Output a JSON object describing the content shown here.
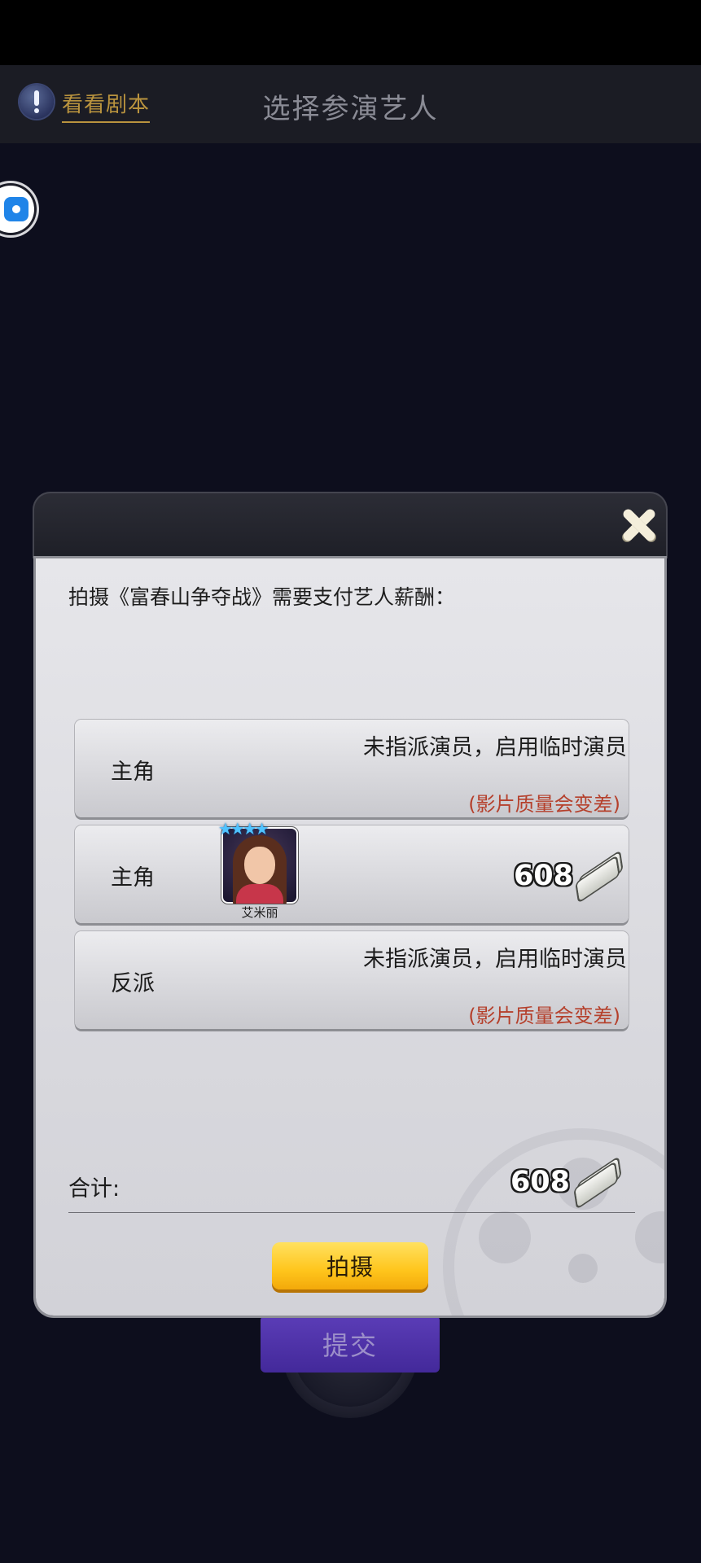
{
  "header": {
    "script_link": "看看剧本",
    "title": "选择参演艺人"
  },
  "background": {
    "submit_label": "提交"
  },
  "dialog": {
    "pay_label": "拍摄《富春山争夺战》需要支付艺人薪酬：",
    "roles": [
      {
        "role": "主角",
        "status": "未指派演员，启用临时演员",
        "warning": "(影片质量会变差)"
      },
      {
        "role": "主角",
        "actor_name": "艾米丽",
        "actor_stars": 4,
        "fee": "608"
      },
      {
        "role": "反派",
        "status": "未指派演员，启用临时演员",
        "warning": "(影片质量会变差)"
      }
    ],
    "total_label": "合计:",
    "total_value": "608",
    "shoot_label": "拍摄"
  },
  "icons": {
    "hint": "exclamation-icon",
    "close": "close-icon",
    "money": "money-icon",
    "float": "assistant-float-icon"
  },
  "colors": {
    "accent_gold": "#b9933e",
    "warning_red": "#b5402c",
    "shoot_button": "#ffc51c",
    "submit_button": "#4b2fa6"
  }
}
